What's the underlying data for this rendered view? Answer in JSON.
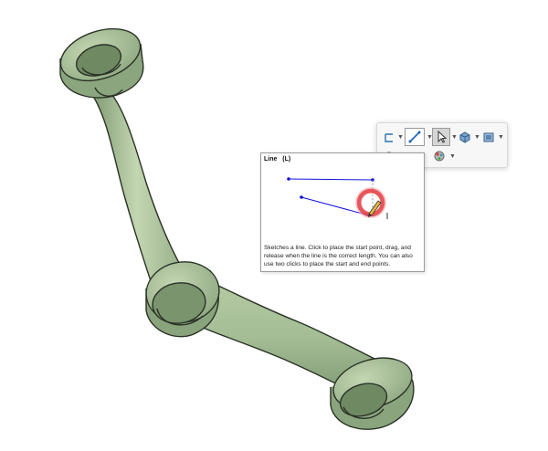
{
  "tooltip": {
    "title": "Line",
    "shortcut": "(L)",
    "description": "Sketches a line. Click to place the start point, drag, and release when the line is the correct length. You can also use two clicks to place the start and end points."
  },
  "toolbar": {
    "rows": [
      [
        "sketch-rectangle-icon",
        "line-icon",
        "select-icon",
        "view-orientation-icon",
        "display-style-icon"
      ],
      [
        "view-icon",
        "sketch-icon",
        "appearance-icon"
      ]
    ],
    "active_tool": "line-icon"
  },
  "colors": {
    "part_fill": "#a9c19a",
    "part_dark": "#7f9a72",
    "part_outline": "#2a3326",
    "sketch_line": "#1111dd",
    "highlight_ring": "#e3383f"
  }
}
